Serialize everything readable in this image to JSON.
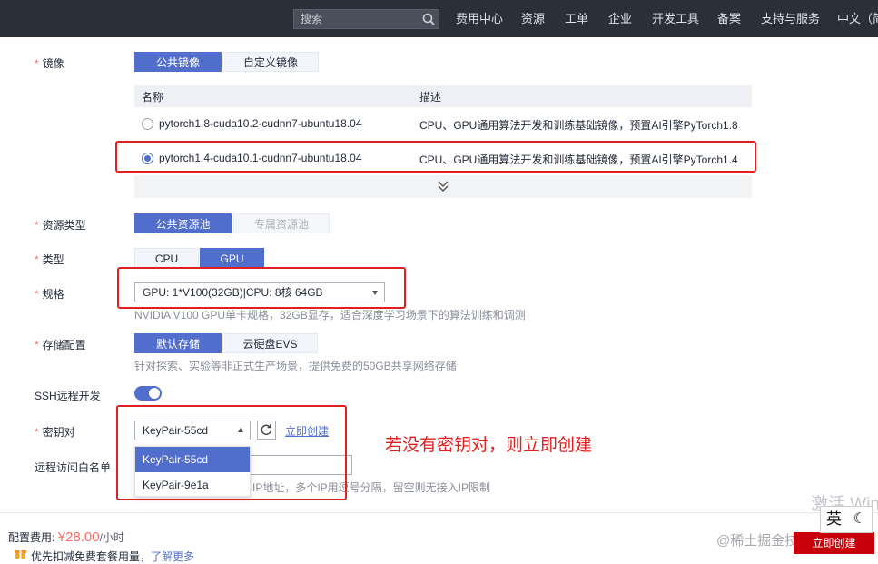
{
  "topbar": {
    "search_placeholder": "搜索",
    "nav": [
      "费用中心",
      "资源",
      "工单",
      "企业",
      "开发工具",
      "备案",
      "支持与服务",
      "中文（简"
    ]
  },
  "form": {
    "image": {
      "label": "镜像",
      "tabs": [
        "公共镜像",
        "自定义镜像"
      ],
      "active_tab": "公共镜像",
      "table_headers": [
        "名称",
        "描述"
      ],
      "rows": [
        {
          "name": "pytorch1.8-cuda10.2-cudnn7-ubuntu18.04",
          "desc": "CPU、GPU通用算法开发和训练基础镜像，预置AI引擎PyTorch1.8",
          "selected": false
        },
        {
          "name": "pytorch1.4-cuda10.1-cudnn7-ubuntu18.04",
          "desc": "CPU、GPU通用算法开发和训练基础镜像，预置AI引擎PyTorch1.4",
          "selected": true
        }
      ]
    },
    "resource_type": {
      "label": "资源类型",
      "options": [
        "公共资源池",
        "专属资源池"
      ],
      "active": "公共资源池"
    },
    "type": {
      "label": "类型",
      "options": [
        "CPU",
        "GPU"
      ],
      "active": "GPU"
    },
    "spec": {
      "label": "规格",
      "value": "GPU: 1*V100(32GB)|CPU: 8核 64GB",
      "hint": "NVIDIA V100 GPU单卡规格，32GB显存，适合深度学习场景下的算法训练和调测"
    },
    "storage": {
      "label": "存储配置",
      "options": [
        "默认存储",
        "云硬盘EVS"
      ],
      "active": "默认存储",
      "hint": "针对探索、实验等非正式生产场景，提供免费的50GB共享网络存储"
    },
    "ssh": {
      "label": "SSH远程开发",
      "enabled": true
    },
    "keypair": {
      "label": "密钥对",
      "value": "KeyPair-55cd",
      "create_link": "立即创建",
      "options": [
        "KeyPair-55cd",
        "KeyPair-9e1a"
      ]
    },
    "whitelist": {
      "label": "远程访问白名单",
      "hint": "IP地址，多个IP用逗号分隔，留空则无接入IP限制"
    }
  },
  "annotation": "若没有密钥对，则立即创建",
  "footer": {
    "cost_label": "配置费用:",
    "price": "¥28.00",
    "per": "/小时",
    "promo_text": "优先扣减免费套餐用量，",
    "promo_link": "了解更多",
    "buy_button": "立即创建",
    "watermark": "@稀土掘金技术社区",
    "activate": "激活 Win",
    "ime": "英"
  },
  "colors": {
    "accent": "#526ecc",
    "required": "#f66f6a",
    "highlight_box": "#e02020",
    "buy_button": "#c7000b",
    "topbar": "#2a2f38"
  }
}
